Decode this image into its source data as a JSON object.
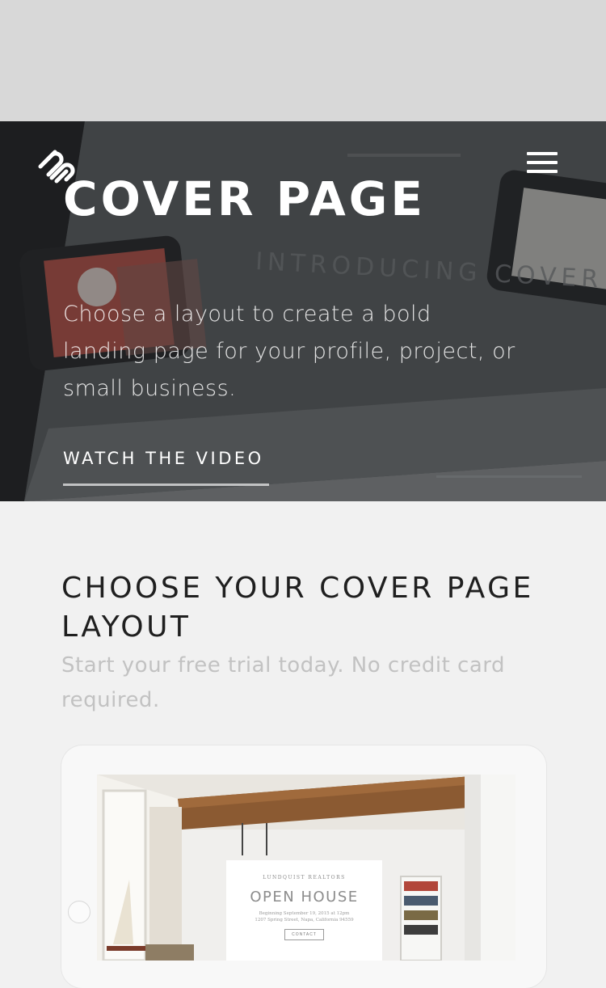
{
  "hero": {
    "title": "COVER PAGE",
    "description": "Choose a layout to create a bold landing page for your profile, project, or small business.",
    "cta_label": "WATCH THE VIDEO",
    "background_text": "INTRODUCING COVER PAGES"
  },
  "header": {
    "logo_icon": "squarespace-logo-icon",
    "menu_icon": "hamburger-menu-icon"
  },
  "section": {
    "title": "CHOOSE YOUR COVER PAGE LAYOUT",
    "subtitle": "Start your free trial today. No credit card required."
  },
  "preview": {
    "realtor": "LUNDQUIST REALTORS",
    "title": "OPEN HOUSE",
    "line1": "Beginning September 19, 2015 at 12pm",
    "line2": "1207 Spring Street, Napa, California 94559",
    "button": "CONTACT"
  },
  "colors": {
    "topbar": "#d8d8d8",
    "page_background": "#f1f1f1",
    "hero_overlay": "#282a2c",
    "heading": "#1f1f1f",
    "subtitle": "#c2c2c2"
  }
}
